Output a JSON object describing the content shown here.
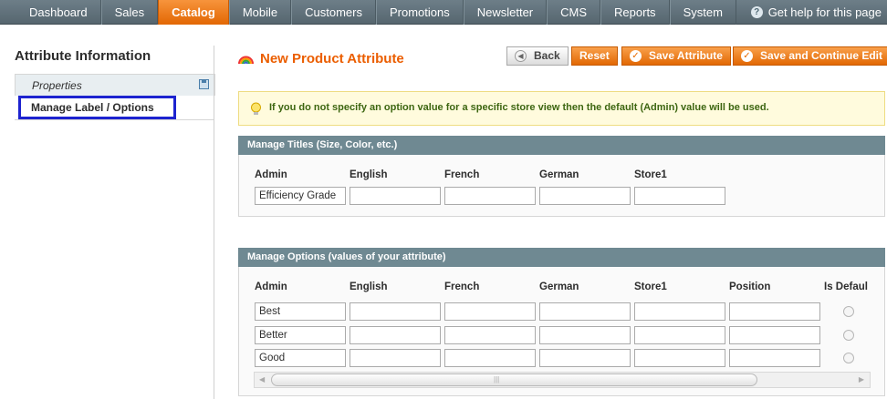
{
  "nav": {
    "items": [
      "Dashboard",
      "Sales",
      "Catalog",
      "Mobile",
      "Customers",
      "Promotions",
      "Newsletter",
      "CMS",
      "Reports",
      "System"
    ],
    "active": "Catalog",
    "help": "Get help for this page"
  },
  "sidebar": {
    "title": "Attribute Information",
    "tabs": [
      {
        "label": "Properties"
      },
      {
        "label": "Manage Label / Options"
      }
    ]
  },
  "header": {
    "title": "New Product Attribute",
    "buttons": {
      "back": "Back",
      "reset": "Reset",
      "save": "Save Attribute",
      "save_continue": "Save and Continue Edit"
    }
  },
  "notice": "If you do not specify an option value for a specific store view then the default (Admin) value will be used.",
  "titles": {
    "heading": "Manage Titles (Size, Color, etc.)",
    "columns": [
      "Admin",
      "English",
      "French",
      "German",
      "Store1"
    ],
    "values": [
      "Efficiency Grade",
      "",
      "",
      "",
      ""
    ]
  },
  "options": {
    "heading": "Manage Options (values of your attribute)",
    "columns": [
      "Admin",
      "English",
      "French",
      "German",
      "Store1",
      "Position",
      "Is Defaul"
    ],
    "rows": [
      {
        "admin": "Best",
        "english": "",
        "french": "",
        "german": "",
        "store1": "",
        "position": "",
        "is_default": false
      },
      {
        "admin": "Better",
        "english": "",
        "french": "",
        "german": "",
        "store1": "",
        "position": "",
        "is_default": false
      },
      {
        "admin": "Good",
        "english": "",
        "french": "",
        "german": "",
        "store1": "",
        "position": "",
        "is_default": false
      }
    ]
  },
  "colors": {
    "accent": "#eb5e00",
    "nav_bg": "#5f7079",
    "section_header": "#6f8992",
    "highlight_outline": "#1d23cf"
  }
}
